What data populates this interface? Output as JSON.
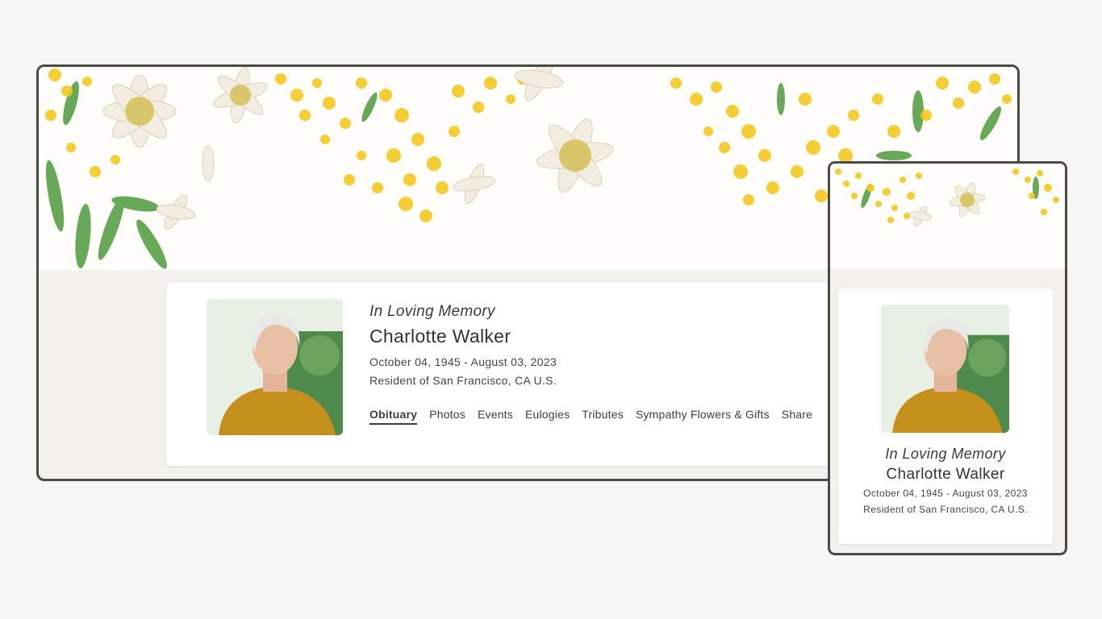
{
  "memorial": {
    "heading": "In Loving Memory",
    "name": "Charlotte Walker",
    "dates": "October 04, 1945 - August 03, 2023",
    "residence": "Resident of San Francisco, CA U.S."
  },
  "nav": {
    "items": [
      "Obituary",
      "Photos",
      "Events",
      "Eulogies",
      "Tributes",
      "Sympathy Flowers & Gifts",
      "Share"
    ],
    "active": "Obituary"
  },
  "colors": {
    "frame_border": "#4b4b46",
    "banner_bg": "#fffdf9",
    "page_bg": "#f2f1ec",
    "flower_yellow": "#f4c81e",
    "flower_white": "#f3ece0",
    "leaf_green": "#4c9a3c",
    "sweater": "#c4901c"
  }
}
